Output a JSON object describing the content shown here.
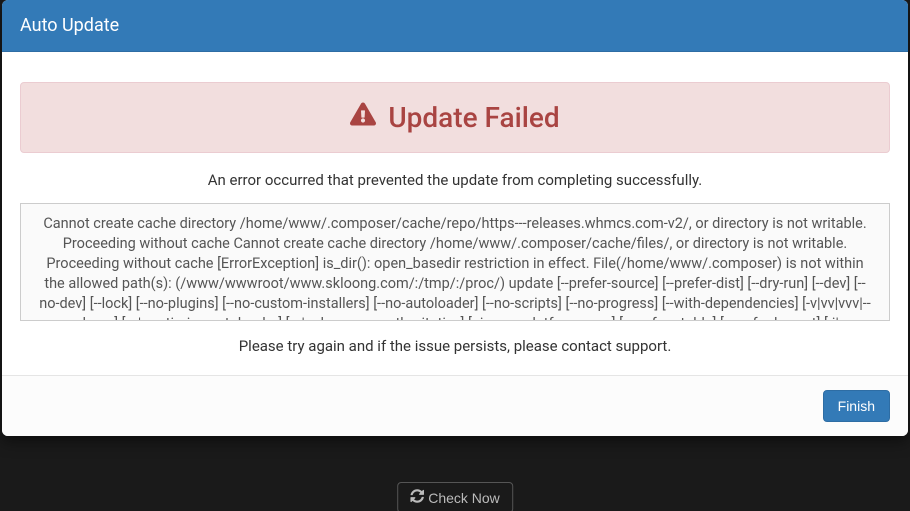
{
  "backdrop": {
    "check_now_label": "Check Now"
  },
  "modal": {
    "title": "Auto Update",
    "alert": {
      "heading": "Update Failed"
    },
    "error_intro": "An error occurred that prevented the update from completing successfully.",
    "log_text": "Cannot create cache directory /home/www/.composer/cache/repo/https---releases.whmcs.com-v2/, or directory is not writable. Proceeding without cache Cannot create cache directory /home/www/.composer/cache/files/, or directory is not writable. Proceeding without cache [ErrorException] is_dir(): open_basedir restriction in effect. File(/home/www/.composer) is not within the allowed path(s): (/www/wwwroot/www.skloong.com/:/tmp/:/proc/) update [--prefer-source] [--prefer-dist] [--dry-run] [--dev] [--no-dev] [--lock] [--no-plugins] [--no-custom-installers] [--no-autoloader] [--no-scripts] [--no-progress] [--with-dependencies] [-v|vv|vvv|--verbose] [-o|--optimize-autoloader] [-a|--classmap-authoritative] [--ignore-platform-reqs] [--prefer-stable] [--prefer-lowest] [-i|--interactive] [--root-reqs] [--] [<packages>]...",
    "retry_msg": "Please try again and if the issue persists, please contact support.",
    "finish_label": "Finish"
  }
}
